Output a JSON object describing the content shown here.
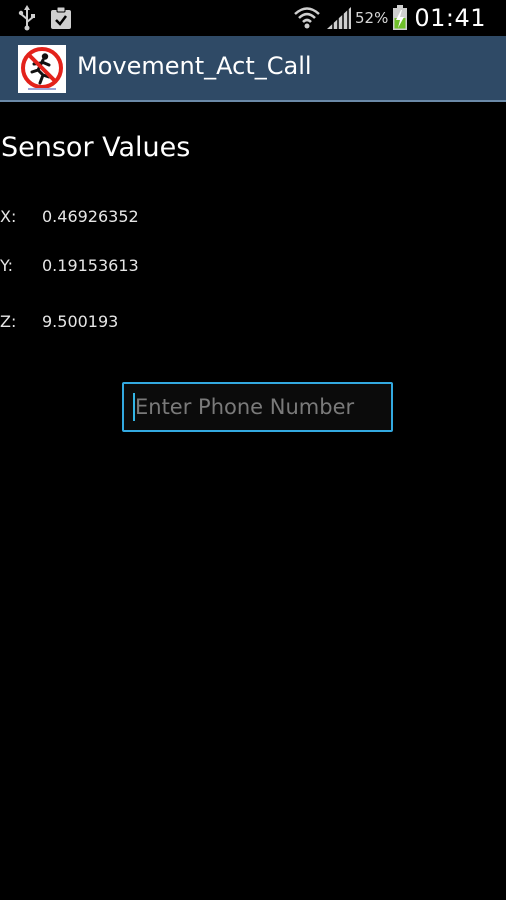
{
  "status_bar": {
    "battery_percent": "52%",
    "time": "01:41",
    "icons": [
      "usb-icon",
      "clipboard-check-icon",
      "wifi-icon",
      "signal-icon",
      "battery-charging-icon"
    ],
    "battery_color": "#6fbf2a"
  },
  "action_bar": {
    "title": "Movement_Act_Call",
    "icon": "no-running-icon",
    "background_color": "#2f4a66"
  },
  "content": {
    "heading": "Sensor Values",
    "sensors": [
      {
        "label": "X:",
        "value": "0.46926352"
      },
      {
        "label": "Y:",
        "value": "0.19153613"
      },
      {
        "label": "Z:",
        "value": "9.500193"
      }
    ],
    "phone_input": {
      "placeholder": "Enter Phone Number",
      "value": "",
      "border_color": "#33a9e0"
    }
  }
}
